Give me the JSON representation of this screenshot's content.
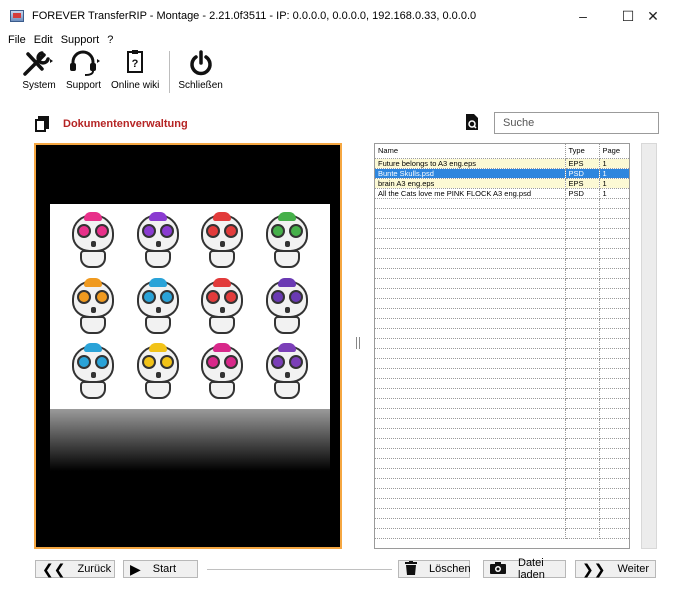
{
  "window": {
    "title": "FOREVER TransferRIP - Montage - 2.21.0f3511 - IP: 0.0.0.0, 0.0.0.0, 192.168.0.33, 0.0.0.0",
    "minimize_glyph": "–",
    "maximize_glyph": "☐",
    "close_glyph": "✕"
  },
  "menu": [
    "File",
    "Edit",
    "Support",
    "?"
  ],
  "toolbar": {
    "items": [
      {
        "label": "System",
        "icon": "wrench-screwdriver-icon"
      },
      {
        "label": "Support",
        "icon": "headset-icon"
      },
      {
        "label": "Online wiki",
        "icon": "help-document-icon"
      },
      {
        "label": "Schließen",
        "icon": "power-icon"
      }
    ]
  },
  "section": {
    "title": "Dokumentenverwaltung",
    "accent": "#b52424"
  },
  "search": {
    "placeholder": "Suche"
  },
  "files": {
    "columns": [
      "Name",
      "Type",
      "Page"
    ],
    "rows": [
      {
        "name": "Future belongs to A3 eng.eps",
        "type": "EPS",
        "page": "1",
        "state": "highlight"
      },
      {
        "name": "Bunte Skulls.psd",
        "type": "PSD",
        "page": "1",
        "state": "selected"
      },
      {
        "name": "brain A3 eng.eps",
        "type": "EPS",
        "page": "1",
        "state": "highlight"
      },
      {
        "name": "All the Cats love me PINK FLOCK A3 eng.psd",
        "type": "PSD",
        "page": "1",
        "state": "normal"
      }
    ],
    "empty_rows": 34,
    "selected_color": "#2e86de",
    "highlight_color": "#fcf9d4"
  },
  "preview": {
    "border_color": "#f5a742",
    "skull_colors": [
      "#e8308a",
      "#8a3bd1",
      "#e23b3b",
      "#46b04a",
      "#f09a1f",
      "#2aa3d8",
      "#e23b3b",
      "#6a3ab3",
      "#2aa3d8",
      "#f2c318",
      "#d8288a",
      "#7b3fb8"
    ]
  },
  "bottom": {
    "back_label": "Zurück",
    "start_label": "Start",
    "delete_label": "Löschen",
    "load_label": "Datei laden",
    "next_label": "Weiter"
  }
}
